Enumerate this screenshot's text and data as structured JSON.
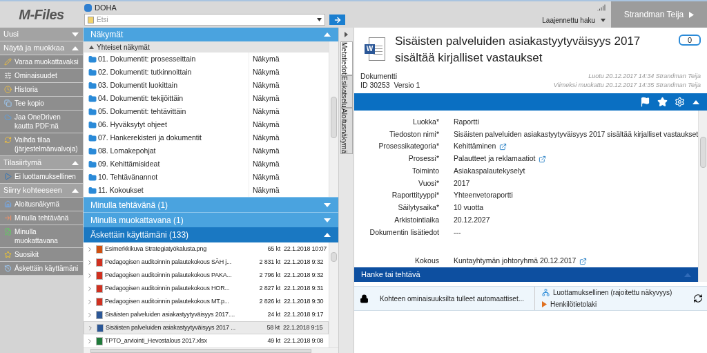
{
  "logo": "M-Files",
  "vault": "DOHA",
  "search": {
    "placeholder": "Etsi"
  },
  "advanced_search": "Laajennettu haku",
  "user": "Strandman Teija",
  "sidebar": {
    "sections": [
      {
        "title": "Uusi",
        "expanded": false
      },
      {
        "title": "Näytä ja muokkaa",
        "expanded": true,
        "items": [
          {
            "label": "Varaa muokattavaksi"
          },
          {
            "label": "Ominaisuudet"
          },
          {
            "label": "Historia"
          },
          {
            "label": "Tee kopio"
          },
          {
            "label": "Jaa OneDriven kautta PDF:nä"
          },
          {
            "label": "Vaihda tilaa (järjestelmänvalvoja)"
          }
        ]
      },
      {
        "title": "Tilasiirtymä",
        "expanded": true,
        "items": [
          {
            "label": "Ei luottamuksellinen"
          }
        ]
      },
      {
        "title": "Siirry kohteeseen",
        "expanded": true,
        "items": [
          {
            "label": "Aloitusnäkymä"
          },
          {
            "label": "Minulla tehtävänä"
          },
          {
            "label": "Minulla muokattavana"
          },
          {
            "label": "Suosikit"
          },
          {
            "label": "Äskettäin käyttämäni"
          }
        ]
      }
    ]
  },
  "views": {
    "title": "Näkymät",
    "expanded": true,
    "group": {
      "title": "Yhteiset näkymät",
      "expanded": true
    },
    "rows": [
      {
        "name": "01. Dokumentit: prosesseittain",
        "type": "Näkymä"
      },
      {
        "name": "02. Dokumentit: tutkinnoittain",
        "type": "Näkymä"
      },
      {
        "name": "03. Dokumentit luokittain",
        "type": "Näkymä"
      },
      {
        "name": "04. Dokumentit: tekijöittäin",
        "type": "Näkymä"
      },
      {
        "name": "05. Dokumentit: tehtävittäin",
        "type": "Näkymä"
      },
      {
        "name": "06. Hyväksytyt ohjeet",
        "type": "Näkymä"
      },
      {
        "name": "07. Hankerekisteri ja dokumentit",
        "type": "Näkymä"
      },
      {
        "name": "08. Lomakepohjat",
        "type": "Näkymä"
      },
      {
        "name": "09. Kehittämisideat",
        "type": "Näkymä"
      },
      {
        "name": "10. Tehtävänannot",
        "type": "Näkymä"
      },
      {
        "name": "11. Kokoukset",
        "type": "Näkymä"
      }
    ]
  },
  "panels": [
    {
      "title": "Minulla tehtävänä (1)",
      "expanded": false
    },
    {
      "title": "Minulla muokattavana (1)",
      "expanded": false
    }
  ],
  "recent": {
    "title": "Äskettäin käyttämäni (133)",
    "expanded": true,
    "rows": [
      {
        "kind": "image",
        "name": "Esimerkkikuva Strategiatyökalusta.png",
        "size": "65 kt",
        "date": "22.1.2018 10:07",
        "selected": false
      },
      {
        "kind": "pdf",
        "name": "Pedagogisen auditoinnin palautekokous SÄH j...",
        "size": "2 831 kt",
        "date": "22.1.2018 9:32",
        "selected": false
      },
      {
        "kind": "pdf",
        "name": "Pedagogisen auditoinnin palautekokous PAKA...",
        "size": "2 796 kt",
        "date": "22.1.2018 9:32",
        "selected": false
      },
      {
        "kind": "pdf",
        "name": "Pedagogisen auditoinnin palautekokous HOR...",
        "size": "2 827 kt",
        "date": "22.1.2018 9:31",
        "selected": false
      },
      {
        "kind": "pdf",
        "name": "Pedagogisen auditoinnin palautekokous MT.p...",
        "size": "2 826 kt",
        "date": "22.1.2018 9:30",
        "selected": false
      },
      {
        "kind": "word",
        "name": "Sisäisten palveluiden asiakastyytyväisyys 2017....",
        "size": "24 kt",
        "date": "22.1.2018 9:17",
        "selected": false
      },
      {
        "kind": "word",
        "name": "Sisäisten palveluiden asiakastyytyväisyys 2017 ...",
        "size": "58 kt",
        "date": "22.1.2018 9:15",
        "selected": true
      },
      {
        "kind": "excel",
        "name": "TPTO_arviointi_Hevostalous 2017.xlsx",
        "size": "49 kt",
        "date": "22.1.2018 9:08",
        "selected": false
      }
    ]
  },
  "side_tabs": [
    {
      "label": "Metatiedot",
      "selected": true
    },
    {
      "label": "Esikatselu",
      "selected": false
    },
    {
      "label": "Aloitusnäkymä",
      "selected": false
    }
  ],
  "document": {
    "icon_letter": "W",
    "title": "Sisäisten palveluiden asiakastyytyväisyys 2017 sisältää kirjalliset vastaukset",
    "type": "Dokumentti",
    "id_version": "ID 30253  Versio 1",
    "created": "Luotu 20.12.2017 14:34 Strandman Teija",
    "modified": "Viimeksi muokattu 20.12.2017 14:35 Strandman Teija",
    "comments": "0"
  },
  "properties": [
    {
      "label": "Luokka*",
      "value": "Raportti",
      "link": false
    },
    {
      "label": "Tiedoston nimi*",
      "value": "Sisäisten palveluiden asiakastyytyväisyys 2017 sisältää kirjalliset vastaukset",
      "link": false
    },
    {
      "label": "Prosessikategoria*",
      "value": "Kehittäminen",
      "link": true
    },
    {
      "label": "Prosessi*",
      "value": "Palautteet ja reklamaatiot",
      "link": true
    },
    {
      "label": "Toiminto",
      "value": "Asiakaspalautekyselyt",
      "link": false
    },
    {
      "label": "Vuosi*",
      "value": "2017",
      "link": false
    },
    {
      "label": "Raporttityyppi*",
      "value": "Yhteenvetoraportti",
      "link": false
    },
    {
      "label": "Säilytysaika*",
      "value": "10 vuotta",
      "link": false
    },
    {
      "label": "Arkistointiaika",
      "value": "20.12.2027",
      "link": false
    },
    {
      "label": "Dokumentin lisätiedot",
      "value": "---",
      "link": false
    },
    {
      "label": "Kokous",
      "value": "Kuntayhtymän johtoryhmä 20.12.2017",
      "link": true,
      "gap": true
    }
  ],
  "section": {
    "title": "Hanke tai tehtävä",
    "expanded": true
  },
  "footer": {
    "automatic": "Kohteen ominaisuuksilta tulleet automaattiset...",
    "items": [
      {
        "kind": "permission",
        "label": "Luottamuksellinen (rajoitettu näkyvyys)"
      },
      {
        "kind": "law",
        "label": "Henkilötietolaki"
      }
    ]
  }
}
